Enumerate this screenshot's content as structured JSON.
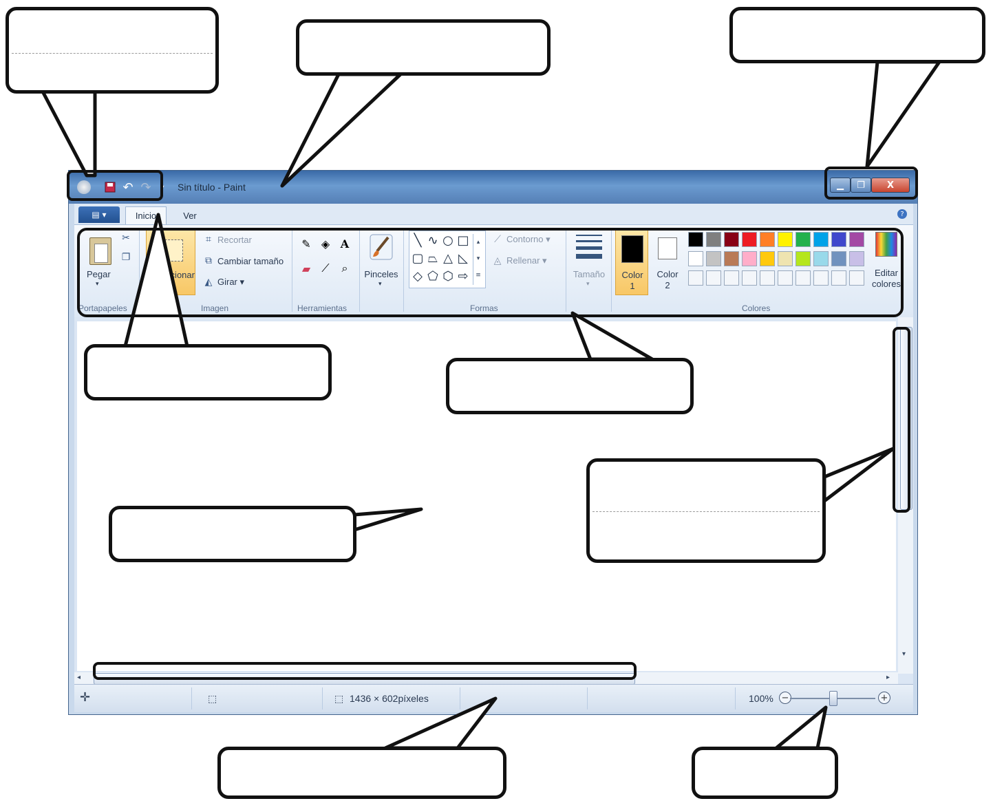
{
  "window": {
    "title": "Sin título - Paint",
    "quick_access": {
      "save_icon": "save-icon",
      "undo_icon": "undo-icon",
      "redo_icon": "redo-icon"
    },
    "controls": {
      "minimize": "▁",
      "maximize": "❐",
      "close": "X"
    }
  },
  "ribbon_tabs": {
    "file_menu_icon": "file-menu-icon",
    "inicio": "Inicio",
    "ver": "Ver",
    "help_icon": "help-icon"
  },
  "ribbon": {
    "portapapeles": {
      "label": "Portapapeles",
      "pegar": "Pegar"
    },
    "imagen": {
      "label": "Imagen",
      "seleccionar": "Seleccionar",
      "recortar": "Recortar",
      "cambiar_tamano": "Cambiar tamaño",
      "girar": "Girar ▾"
    },
    "herramientas": {
      "label": "Herramientas"
    },
    "pinceles": {
      "label": "Pinceles"
    },
    "formas": {
      "label": "Formas",
      "contorno": "Contorno ▾",
      "rellenar": "Rellenar ▾"
    },
    "tamano": {
      "label": "Tamaño"
    },
    "colores": {
      "label": "Colores",
      "color1": "Color",
      "color1_num": "1",
      "color2": "Color",
      "color2_num": "2",
      "editar": "Editar",
      "editar2": "colores",
      "palette_row1": [
        "#000000",
        "#7f7f7f",
        "#880015",
        "#ed1c24",
        "#ff7f27",
        "#fff200",
        "#22b14c",
        "#00a2e8",
        "#3f48cc",
        "#a349a4"
      ],
      "palette_row2": [
        "#ffffff",
        "#c3c3c3",
        "#b97a57",
        "#ffaec9",
        "#ffc90e",
        "#efe4b0",
        "#b5e61d",
        "#99d9ea",
        "#7092be",
        "#c8bfe7"
      ],
      "color1_value": "#000000",
      "color2_value": "#ffffff"
    }
  },
  "statusbar": {
    "size_text": "1436 × 602píxeles",
    "zoom": "100%",
    "zoom_level_percent": 100,
    "zoom_out": "−",
    "zoom_in": "+"
  }
}
